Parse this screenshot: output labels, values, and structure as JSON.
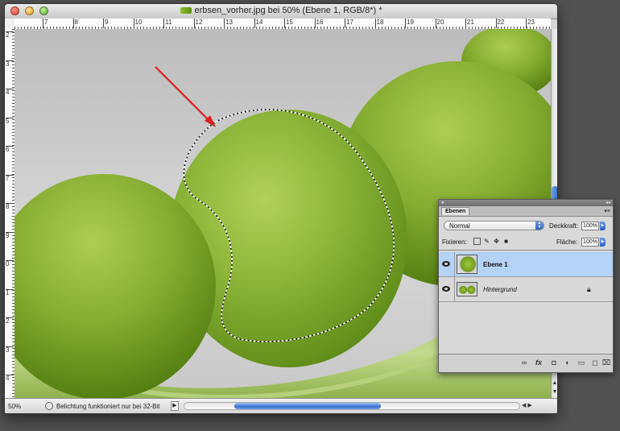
{
  "window": {
    "title": "erbsen_vorher.jpg bei 50% (Ebene 1, RGB/8*) *"
  },
  "rulers": {
    "top_ticks": [
      "7",
      "8",
      "9",
      "10",
      "11",
      "12",
      "13",
      "14",
      "15",
      "16",
      "17",
      "18",
      "19",
      "20",
      "21",
      "22",
      "23"
    ],
    "left_ticks": [
      "2",
      "3",
      "4",
      "5",
      "6",
      "7",
      "8",
      "9",
      "0",
      "1",
      "2",
      "3",
      "4"
    ]
  },
  "status": {
    "zoom": "50%",
    "message": "Belichtung funktioniert nur bei 32-Bit"
  },
  "layers_panel": {
    "tab": "Ebenen",
    "blend_mode": "Normal",
    "opacity_label": "Deckkraft:",
    "opacity_value": "100%",
    "lock_label": "Fixieren:",
    "fill_label": "Fläche:",
    "fill_value": "100%",
    "layers": [
      {
        "name": "Ebene 1",
        "selected": true
      },
      {
        "name": "Hintergrund",
        "selected": false,
        "locked": true
      }
    ]
  },
  "colors": {
    "annotation_red": "#e01e1e",
    "selection_highlight": "#b5d3f7",
    "pea_green": "#8cb53a"
  },
  "icons": [
    "close-light",
    "minimize-light",
    "zoom-light",
    "eye-icon",
    "lock-icon",
    "link-icon",
    "fx-icon",
    "mask-icon",
    "adjustment-icon",
    "folder-icon",
    "new-layer-icon",
    "trash-icon"
  ]
}
